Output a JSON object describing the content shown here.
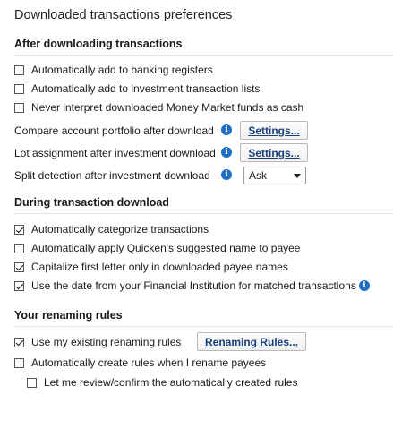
{
  "title": "Downloaded transactions preferences",
  "after": {
    "heading": "After downloading transactions",
    "options": [
      {
        "label": "Automatically add to banking registers",
        "checked": false
      },
      {
        "label": "Automatically add to investment transaction lists",
        "checked": false
      },
      {
        "label": "Never interpret downloaded Money Market funds as cash",
        "checked": false
      }
    ],
    "compare_label": "Compare account portfolio after download",
    "lot_label": "Lot assignment after investment download",
    "split_label": "Split detection after investment download",
    "settings_label": "Settings...",
    "split_value": "Ask"
  },
  "during": {
    "heading": "During transaction download",
    "options": [
      {
        "label": "Automatically categorize transactions",
        "checked": true
      },
      {
        "label": "Automatically apply Quicken's suggested name to payee",
        "checked": false
      },
      {
        "label": "Capitalize first letter only in downloaded payee names",
        "checked": true
      },
      {
        "label": "Use the date from your Financial Institution for matched transactions",
        "checked": true
      }
    ]
  },
  "renaming": {
    "heading": "Your renaming rules",
    "options": [
      {
        "label": "Use my existing renaming rules",
        "checked": true
      },
      {
        "label": "Automatically create rules when I rename payees",
        "checked": false
      },
      {
        "label": "Let me review/confirm the automatically created rules",
        "checked": false
      }
    ],
    "rules_button": "Renaming Rules..."
  },
  "icons": {
    "info": "info-icon",
    "checkbox_checked": "check-mark-icon",
    "dropdown": "chevron-down-icon"
  },
  "colors": {
    "info": "#1e6fc4",
    "button_text": "#1a3f7a"
  }
}
